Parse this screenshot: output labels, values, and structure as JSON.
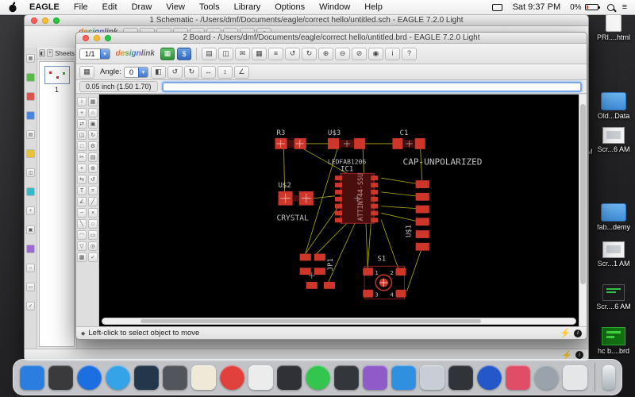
{
  "menubar": {
    "app": "EAGLE",
    "items": [
      "File",
      "Edit",
      "Draw",
      "View",
      "Tools",
      "Library",
      "Options",
      "Window",
      "Help"
    ],
    "time": "Sat 9:37 PM",
    "battery_percent": "0%",
    "icons": {
      "list": "≡"
    }
  },
  "schematic": {
    "title": "1 Schematic - /Users/dmf/Documents/eagle/correct hello/untitled.sch - EAGLE 7.2.0 Light",
    "sheets_label": "Sheets",
    "sheet_number": "1",
    "logo_design": "design",
    "logo_link": "link",
    "icons": {
      "panel": "◧",
      "close": "×"
    },
    "toolbar_icons": [
      "▤",
      "◫",
      "✉",
      "▦",
      "↺",
      "↻",
      "⊕",
      "⊖",
      "?"
    ],
    "left_tools": [
      {
        "g": "▦",
        "c": ""
      },
      {
        "g": "",
        "c": "#57b947"
      },
      {
        "g": "",
        "c": "#d9534f"
      },
      {
        "g": "",
        "c": "#4a86d8"
      },
      {
        "g": "▤",
        "c": ""
      },
      {
        "g": "",
        "c": "#e8c23a"
      },
      {
        "g": "◫",
        "c": ""
      },
      {
        "g": "",
        "c": "#3ab8c8"
      },
      {
        "g": "+",
        "c": ""
      },
      {
        "g": "▣",
        "c": ""
      },
      {
        "g": "",
        "c": "#9a6ad0"
      },
      {
        "g": "○",
        "c": ""
      },
      {
        "g": "▭",
        "c": ""
      },
      {
        "g": "✓",
        "c": ""
      }
    ]
  },
  "board": {
    "title": "2 Board - /Users/dmf/Documents/eagle/correct hello/untitled.brd - EAGLE 7.2.0 Light",
    "sheet_combo": "1/1",
    "logo_design": "design",
    "logo_link": "link",
    "angle_label": "Angle:",
    "angle_value": "0",
    "coords": "0.05 inch (1.50 1.70)",
    "command_value": "",
    "status_text": "Left-click to select object to move",
    "icons": {
      "grid": "▦",
      "pcb_service": "▦",
      "pcb_quote": "$",
      "dropdown": "▾",
      "status_marker": "◆",
      "bolt": "⚡",
      "info": "i"
    },
    "toolbar1_icons": [
      "▤",
      "◫",
      "✉",
      "▦",
      "≡",
      "↺",
      "↻",
      "⊕",
      "⊖",
      "⊘",
      "◉",
      "i",
      "?"
    ],
    "toolbar2_icons": [
      "◧",
      "↺",
      "↻",
      "↔",
      "↕",
      "∠"
    ],
    "tool_palette": [
      "i",
      "▦",
      "+",
      "⌂",
      "⇄",
      "▣",
      "◫",
      "↻",
      "□",
      "⚙",
      "✂",
      "▤",
      "×",
      "⊕",
      "⇆",
      "↺",
      "T",
      "=",
      "∠",
      "╱",
      "~",
      "×",
      "╲",
      "○",
      "◠",
      "▭",
      "▽",
      "◎",
      "▩",
      "✓"
    ],
    "labels": {
      "r3": "R3",
      "u3": "U$3",
      "u3_value": "LEDFAB1206",
      "c1": "C1",
      "c1_value": "CAP-UNPOLARIZED",
      "ic1": "IC1",
      "ic1_value": "ATTINY44-SSU",
      "u2": "U$2",
      "u2_value": "CRYSTAL",
      "u1": "U$1",
      "jp1": "JP1",
      "s1": "S1",
      "pin1": "1",
      "pin2": "2",
      "pin3": "3",
      "pin4": "4"
    },
    "colors": {
      "pad": "#cd3628",
      "body": "#4a0e0e",
      "airwire": "#b9b918",
      "label": "#c4c4c4",
      "canvas": "#000000"
    }
  },
  "desktop_icons": [
    {
      "label": "PRI....html"
    },
    {
      "label": "Old...Data"
    },
    {
      "label": "Scr...6 AM"
    },
    {
      "label": "fab...demy"
    },
    {
      "label": "Scr...1 AM"
    },
    {
      "label": "Scr....6 AM"
    },
    {
      "label": "hc b....brd"
    },
    {
      "label": "PM"
    }
  ],
  "dock": {
    "items": [
      {
        "name": "finder",
        "color": "#2b7de0",
        "r": "7px"
      },
      {
        "name": "launchpad",
        "color": "#3a3a3c",
        "r": "7px"
      },
      {
        "name": "app-store",
        "color": "#1c6fe0",
        "r": "50%"
      },
      {
        "name": "safari",
        "color": "#35a3e8",
        "r": "50%"
      },
      {
        "name": "mail",
        "color": "#23364a",
        "r": "7px"
      },
      {
        "name": "contacts",
        "color": "#52555a",
        "r": "7px"
      },
      {
        "name": "notes",
        "color": "#efe9d8",
        "r": "7px"
      },
      {
        "name": "itunes",
        "color": "#e0413c",
        "r": "50%"
      },
      {
        "name": "photos",
        "color": "#ececec",
        "r": "7px"
      },
      {
        "name": "messages",
        "color": "#2f3136",
        "r": "7px"
      },
      {
        "name": "facetime",
        "color": "#34c54e",
        "r": "50%"
      },
      {
        "name": "calendar",
        "color": "#33363b",
        "r": "7px"
      },
      {
        "name": "ibooks",
        "color": "#8e5bc8",
        "r": "7px"
      },
      {
        "name": "maps",
        "color": "#2f8fe0",
        "r": "7px"
      },
      {
        "name": "calculator",
        "color": "#c9ced6",
        "r": "7px"
      },
      {
        "name": "reminders",
        "color": "#303338",
        "r": "7px"
      },
      {
        "name": "network",
        "color": "#2458c8",
        "r": "50%"
      },
      {
        "name": "music",
        "color": "#e04e66",
        "r": "7px"
      },
      {
        "name": "system-preferences",
        "color": "#9aa2ab",
        "r": "50%"
      },
      {
        "name": "printer",
        "color": "#e4e6e8",
        "r": "7px"
      }
    ]
  }
}
